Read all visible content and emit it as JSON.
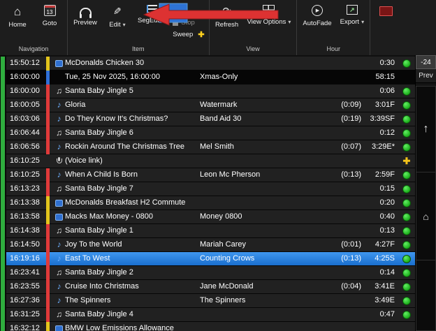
{
  "colors": {
    "bar_red": "#e03a3a",
    "bar_yellow": "#e2c41c",
    "bar_blue": "#2f6fd6",
    "bar_none": "transparent",
    "status_green": "#2fbf3a",
    "selection_blue": "#2b84e0",
    "onair_green": "#2fae3e",
    "annotation_red": "#dd3232",
    "annotation_blue": "#2e73d4",
    "sweep_plus_yellow": "#ffd21e"
  },
  "toolbar": {
    "groups": [
      {
        "label": "Navigation",
        "buttons": [
          {
            "name": "home",
            "label": "Home",
            "icon": "home"
          },
          {
            "name": "goto",
            "label": "Goto",
            "icon": "calendar",
            "calendar_day": "13"
          }
        ]
      },
      {
        "label": "Item",
        "buttons": [
          {
            "name": "preview",
            "label": "Preview",
            "icon": "headphones"
          },
          {
            "name": "edit",
            "label": "Edit",
            "icon": "pencil",
            "dropdown": true
          },
          {
            "name": "segedit",
            "label": "SegEdit",
            "icon": "segedit",
            "dropdown": true
          },
          {
            "name": "stop-sweep",
            "stack": [
              {
                "label": "Stop",
                "icon": "stop",
                "disabled": true
              },
              {
                "label": "Sweep",
                "plus": true
              }
            ]
          }
        ]
      },
      {
        "label": "View",
        "buttons": [
          {
            "name": "refresh",
            "label": "Refresh",
            "icon": "refresh"
          },
          {
            "name": "view-options",
            "label": "View Options",
            "icon": "grid",
            "dropdown": true
          }
        ]
      },
      {
        "label": "Hour",
        "buttons": [
          {
            "name": "autofade",
            "label": "AutoFade",
            "icon": "autofade"
          },
          {
            "name": "export",
            "label": "Export",
            "icon": "export",
            "dropdown": true
          }
        ]
      }
    ]
  },
  "right_panel": {
    "offset_label": "-24",
    "prev_label": "Prev"
  },
  "playlist": {
    "rows": [
      {
        "time": "15:50:12",
        "bar": "yellow",
        "icon": "advert",
        "title": "McDonalds Chicken 30",
        "artist": "",
        "intro": "",
        "dur": "0:30",
        "status": "green"
      },
      {
        "time": "16:00:00",
        "kind": "hour",
        "bar": "blue",
        "icon": "",
        "title": "Tue, 25 Nov 2025, 16:00:00",
        "artist": "Xmas-Only",
        "intro": "",
        "dur": "58:15",
        "status": ""
      },
      {
        "time": "16:00:00",
        "bar": "red",
        "icon": "jingle",
        "title": "Santa Baby Jingle 5",
        "artist": "",
        "intro": "",
        "dur": "0:06",
        "status": "green"
      },
      {
        "time": "16:00:05",
        "bar": "red",
        "icon": "song",
        "title": "Gloria",
        "artist": "Watermark",
        "intro": "(0:09)",
        "dur": "3:01F",
        "status": "green"
      },
      {
        "time": "16:03:06",
        "bar": "red",
        "icon": "song",
        "title": "Do They Know It's Christmas?",
        "artist": "Band Aid 30",
        "intro": "(0:19)",
        "dur": "3:39SF",
        "status": "green"
      },
      {
        "time": "16:06:44",
        "bar": "red",
        "icon": "jingle",
        "title": "Santa Baby Jingle 6",
        "artist": "",
        "intro": "",
        "dur": "0:12",
        "status": "green"
      },
      {
        "time": "16:06:56",
        "bar": "red",
        "icon": "song",
        "title": "Rockin Around The Christmas Tree",
        "artist": "Mel Smith",
        "intro": "(0:07)",
        "dur": "3:29E*",
        "status": "green"
      },
      {
        "time": "16:10:25",
        "bar": "none",
        "icon": "voice",
        "title": "(Voice link)",
        "artist": "",
        "intro": "",
        "dur": "",
        "status": "plus"
      },
      {
        "time": "16:10:25",
        "bar": "red",
        "icon": "song",
        "title": "When A Child Is Born",
        "artist": "Leon Mc Pherson",
        "intro": "(0:13)",
        "dur": "2:59F",
        "status": "green"
      },
      {
        "time": "16:13:23",
        "bar": "red",
        "icon": "jingle",
        "title": "Santa Baby Jingle 7",
        "artist": "",
        "intro": "",
        "dur": "0:15",
        "status": "green"
      },
      {
        "time": "16:13:38",
        "bar": "yellow",
        "icon": "advert",
        "title": "McDonalds Breakfast H2 Commute",
        "artist": "",
        "intro": "",
        "dur": "0:20",
        "status": "green"
      },
      {
        "time": "16:13:58",
        "bar": "yellow",
        "icon": "advert",
        "title": "Macks Max Money - 0800",
        "artist": "Money 0800",
        "intro": "",
        "dur": "0:40",
        "status": "green"
      },
      {
        "time": "16:14:38",
        "bar": "red",
        "icon": "jingle",
        "title": "Santa Baby Jingle 1",
        "artist": "",
        "intro": "",
        "dur": "0:13",
        "status": "green"
      },
      {
        "time": "16:14:50",
        "bar": "red",
        "icon": "song",
        "title": "Joy To the World",
        "artist": "Mariah Carey",
        "intro": "(0:01)",
        "dur": "4:27F",
        "status": "green"
      },
      {
        "time": "16:19:16",
        "bar": "red",
        "icon": "song",
        "title": "East To West",
        "artist": "Counting Crows",
        "intro": "(0:13)",
        "dur": "4:25S",
        "status": "green",
        "selected": true
      },
      {
        "time": "16:23:41",
        "bar": "red",
        "icon": "jingle",
        "title": "Santa Baby Jingle 2",
        "artist": "",
        "intro": "",
        "dur": "0:14",
        "status": "green"
      },
      {
        "time": "16:23:55",
        "bar": "red",
        "icon": "song",
        "title": "Cruise Into Christmas",
        "artist": "Jane McDonald",
        "intro": "(0:04)",
        "dur": "3:41E",
        "status": "green"
      },
      {
        "time": "16:27:36",
        "bar": "red",
        "icon": "song",
        "title": "The Spinners",
        "artist": "The Spinners",
        "intro": "",
        "dur": "3:49E",
        "status": "green"
      },
      {
        "time": "16:31:25",
        "bar": "red",
        "icon": "jingle",
        "title": "Santa Baby Jingle 4",
        "artist": "",
        "intro": "",
        "dur": "0:47",
        "status": "green"
      },
      {
        "time": "16:32:12",
        "bar": "yellow",
        "icon": "advert",
        "title": "BMW Low Emissions Allowance",
        "artist": "",
        "intro": "",
        "dur": "",
        "status": ""
      }
    ]
  }
}
